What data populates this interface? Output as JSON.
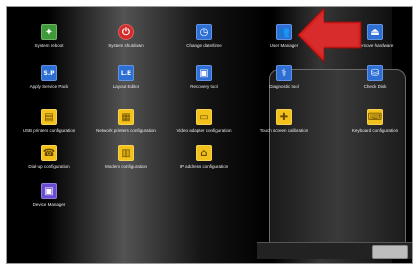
{
  "icons": [
    {
      "label": "System reboot",
      "icon": "reboot-icon",
      "color": "#3f9a3a",
      "glyph": "✦"
    },
    {
      "label": "System shutdown",
      "icon": "power-icon",
      "color": "#d22b2b",
      "glyph": "⏻"
    },
    {
      "label": "Change date/time",
      "icon": "clock-icon",
      "color": "#2e6fd6",
      "glyph": "◷"
    },
    {
      "label": "User Manager",
      "icon": "users-icon",
      "color": "#2e6fd6",
      "glyph": "👥"
    },
    {
      "label": "Remove hardware",
      "icon": "eject-icon",
      "color": "#2e6fd6",
      "glyph": "⏏"
    },
    {
      "label": "Apply Service Pack",
      "icon": "service-pack-icon",
      "color": "#2e6fd6",
      "glyph": "S.P"
    },
    {
      "label": "Layout Editor",
      "icon": "layout-editor-icon",
      "color": "#2e6fd6",
      "glyph": "L.E"
    },
    {
      "label": "Recovery tool",
      "icon": "recovery-icon",
      "color": "#2e6fd6",
      "glyph": "▣"
    },
    {
      "label": "Diagnostic tool",
      "icon": "diagnostic-icon",
      "color": "#2e6fd6",
      "glyph": "⚕"
    },
    {
      "label": "Check Disk",
      "icon": "check-disk-icon",
      "color": "#2e6fd6",
      "glyph": "⛁"
    },
    {
      "label": "USB printers configuration",
      "icon": "usb-printer-icon",
      "color": "#f2c21b",
      "glyph": "▤"
    },
    {
      "label": "Network printers configuration",
      "icon": "network-printer-icon",
      "color": "#f2c21b",
      "glyph": "▦"
    },
    {
      "label": "Video adapter configuration",
      "icon": "video-adapter-icon",
      "color": "#f2c21b",
      "glyph": "▭"
    },
    {
      "label": "Touch screen calibration",
      "icon": "touch-calibration-icon",
      "color": "#f2c21b",
      "glyph": "✚"
    },
    {
      "label": "Keyboard configuration",
      "icon": "keyboard-icon",
      "color": "#f2c21b",
      "glyph": "⌨"
    },
    {
      "label": "Dial-up configuration",
      "icon": "dialup-icon",
      "color": "#f2c21b",
      "glyph": "☎"
    },
    {
      "label": "Modem configuration",
      "icon": "modem-icon",
      "color": "#f2c21b",
      "glyph": "▥"
    },
    {
      "label": "IP address configuration",
      "icon": "ip-address-icon",
      "color": "#f2c21b",
      "glyph": "⌂"
    },
    {
      "label": "Device Manager",
      "icon": "device-manager-icon",
      "color": "#6b4bd1",
      "glyph": "▣"
    }
  ],
  "arrow": {
    "color": "#d61f1f",
    "icon": "pointer-arrow-icon"
  }
}
